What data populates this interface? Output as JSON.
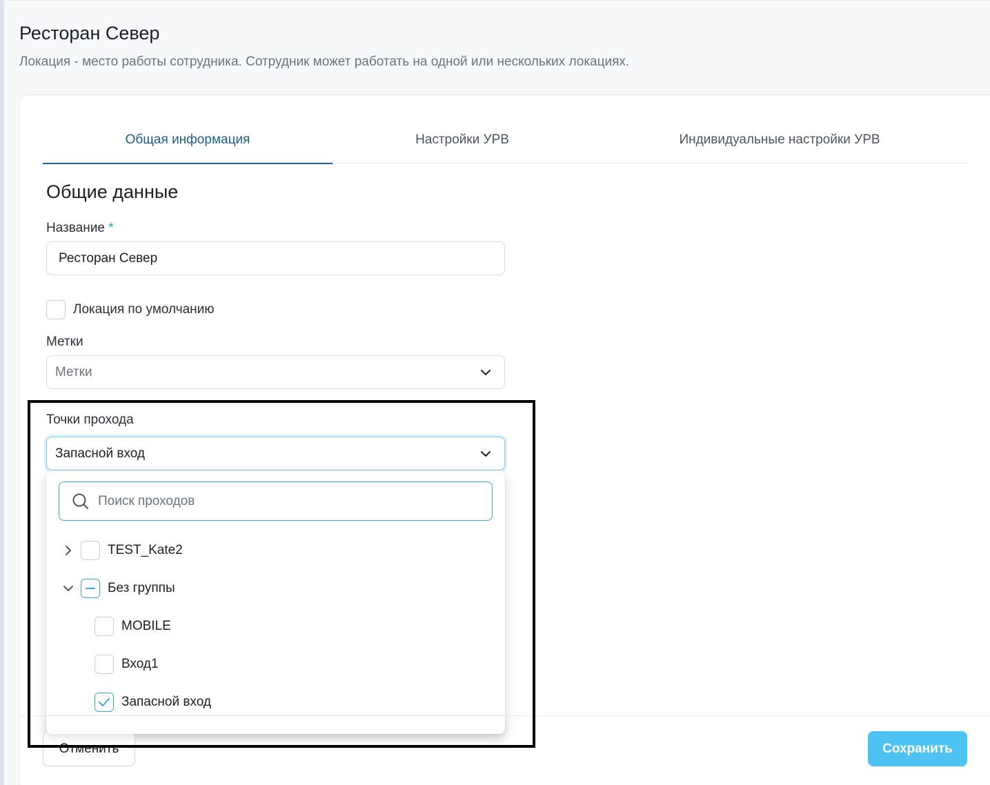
{
  "page": {
    "title": "Ресторан Север",
    "subtitle": "Локация - место работы сотрудника. Сотрудник может работать на одной или нескольких локациях."
  },
  "tabs": [
    {
      "label": "Общая информация",
      "active": true
    },
    {
      "label": "Настройки УРВ",
      "active": false
    },
    {
      "label": "Индивидуальные настройки УРВ",
      "active": false
    }
  ],
  "section": {
    "title": "Общие данные"
  },
  "form": {
    "name_label": "Название",
    "required_mark": "*",
    "name_value": "Ресторан Север",
    "default_location_label": "Локация по умолчанию",
    "default_location_checked": false,
    "tags_label": "Метки",
    "tags_placeholder": "Метки",
    "access_points_label": "Точки прохода",
    "access_points_value": "Запасной вход"
  },
  "dropdown": {
    "search_placeholder": "Поиск проходов",
    "tree": [
      {
        "label": "TEST_Kate2",
        "expanded": false,
        "state": "unchecked"
      },
      {
        "label": "Без группы",
        "expanded": true,
        "state": "partial",
        "children": [
          {
            "label": "MOBILE",
            "state": "unchecked"
          },
          {
            "label": "Вход1",
            "state": "unchecked"
          },
          {
            "label": "Запасной вход",
            "state": "checked"
          }
        ]
      }
    ]
  },
  "footer": {
    "cancel_label": "Отменить",
    "save_label": "Сохранить"
  },
  "colors": {
    "accent": "#1a5f8e",
    "primary_button": "#4cc3f2",
    "focus_border": "#3aa6d4",
    "required": "#1ea0d6"
  }
}
